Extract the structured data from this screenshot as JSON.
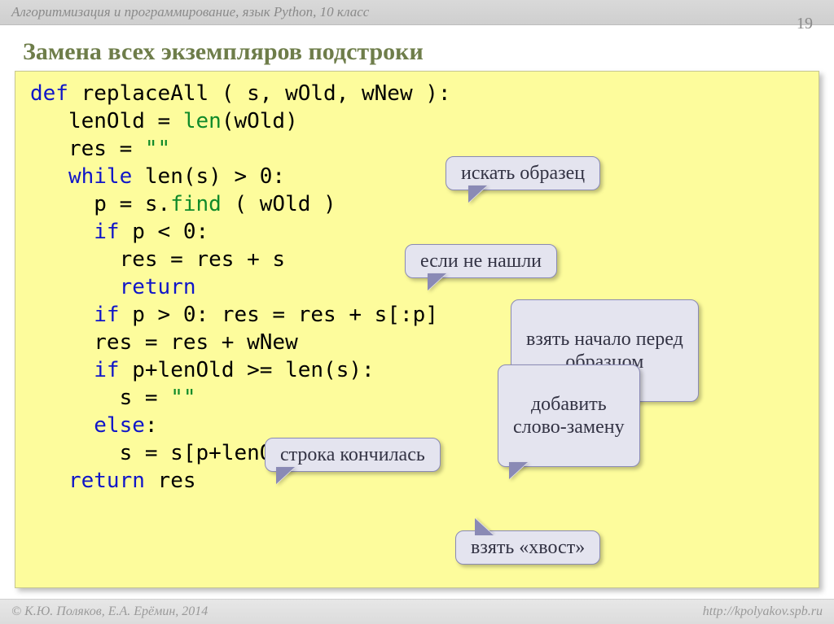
{
  "header": {
    "breadcrumb": "Алгоритмизация и программирование, язык Python, 10 класс",
    "page_number": "19"
  },
  "title": "Замена всех экземпляров подстроки",
  "code": {
    "l1a": "def",
    "l1b": " replaceAll ( s, wOld, wNew ):",
    "l2a": "   lenOld = ",
    "l2b": "len",
    "l2c": "(wOld)",
    "l3a": "   res = ",
    "l3b": "\"\"",
    "l4a": "   ",
    "l4b": "while",
    "l4c": " len(s) > 0:",
    "l5a": "     p = s.",
    "l5b": "find",
    "l5c": " ( wOld )",
    "l6a": "     ",
    "l6b": "if",
    "l6c": " p < 0:",
    "l7": "       res = res + s",
    "l8a": "       ",
    "l8b": "return",
    "l9a": "     ",
    "l9b": "if",
    "l9c": " p > 0: res = res + s[:p]",
    "l10": "     res = res + wNew",
    "l11a": "     ",
    "l11b": "if",
    "l11c": " p+lenOld >= len(s):",
    "l12a": "       s = ",
    "l12b": "\"\"",
    "l13a": "     ",
    "l13b": "else",
    "l13c": ":",
    "l14": "       s = s[p+lenOld:]",
    "l15a": "   ",
    "l15b": "return",
    "l15c": " res"
  },
  "callouts": {
    "c1": "искать образец",
    "c2": "если не нашли",
    "c3": "взять начало перед\nобразцом",
    "c4": "добавить\nслово-замену",
    "c5": "строка кончилась",
    "c6": "взять «хвост»"
  },
  "footer": {
    "left": "© К.Ю. Поляков, Е.А. Ерёмин, 2014",
    "right": "http://kpolyakov.spb.ru"
  }
}
